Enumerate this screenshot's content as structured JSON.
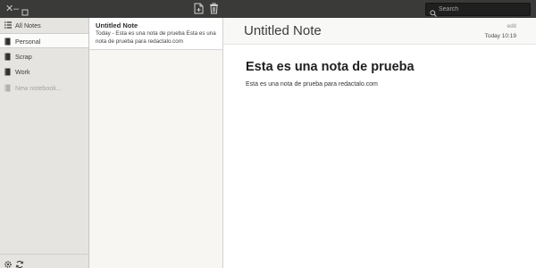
{
  "titlebar": {
    "window_controls": {
      "close": "✕",
      "minimize": "–"
    },
    "icons": [
      "new-note-icon",
      "trash-icon",
      "search-icon"
    ],
    "search": {
      "placeholder": "Search",
      "value": ""
    }
  },
  "sidebar": {
    "items": [
      {
        "label": "All Notes",
        "icon": "list-icon",
        "selected": false
      },
      {
        "label": "Personal",
        "icon": "notebook-icon",
        "selected": true
      },
      {
        "label": "Scrap",
        "icon": "notebook-icon",
        "selected": false
      },
      {
        "label": "Work",
        "icon": "notebook-icon",
        "selected": false
      },
      {
        "label": "New notebook...",
        "icon": "notebook-icon",
        "selected": false
      }
    ],
    "bottom_icons": [
      "gear-icon",
      "sync-icon"
    ]
  },
  "notelist": {
    "notes": [
      {
        "title": "Untitled Note",
        "preview": "Today - Esta es una nota de prueba Esta es una nota de prueba para redactalo.com"
      }
    ]
  },
  "editor": {
    "title": "Untitled Note",
    "edit_label": "edit",
    "date": "Today 10:19",
    "heading": "Esta es una nota de prueba",
    "body": "Esta es una nota de prueba para redactalo.com"
  },
  "colors": {
    "titlebar": "#3a3a38",
    "sidebar": "#e5e4e1",
    "selected_item": "#fbfbfa",
    "editor_bg": "#ffffff"
  }
}
